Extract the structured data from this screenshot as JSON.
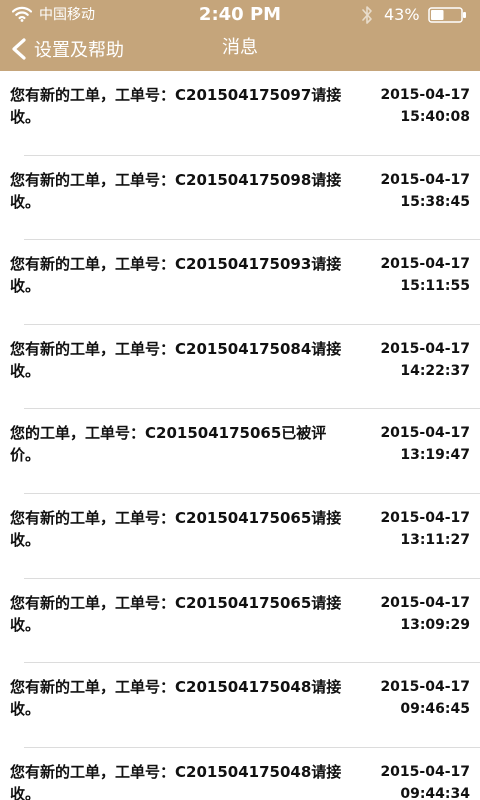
{
  "status_bar": {
    "carrier": "中国移动",
    "time": "2:40 PM",
    "battery_percent": "43%"
  },
  "nav": {
    "back_label": "设置及帮助",
    "title": "消息"
  },
  "colors": {
    "header_bg": "#c5a57b",
    "header_text": "#ffffff",
    "divider": "#dcdcdc"
  },
  "icons": {
    "wifi": "wifi-icon",
    "bluetooth": "bluetooth-icon",
    "battery": "battery-icon",
    "back": "chevron-left-icon"
  },
  "battery_level": 0.43,
  "messages": [
    {
      "text": "您有新的工单，工单号：C201504175097请接收。",
      "date": "2015-04-17",
      "time": "15:40:08"
    },
    {
      "text": "您有新的工单，工单号：C201504175098请接收。",
      "date": "2015-04-17",
      "time": "15:38:45"
    },
    {
      "text": "您有新的工单，工单号：C201504175093请接收。",
      "date": "2015-04-17",
      "time": "15:11:55"
    },
    {
      "text": "您有新的工单，工单号：C201504175084请接收。",
      "date": "2015-04-17",
      "time": "14:22:37"
    },
    {
      "text": "您的工单，工单号：C201504175065已被评价。",
      "date": "2015-04-17",
      "time": "13:19:47"
    },
    {
      "text": "您有新的工单，工单号：C201504175065请接收。",
      "date": "2015-04-17",
      "time": "13:11:27"
    },
    {
      "text": "您有新的工单，工单号：C201504175065请接收。",
      "date": "2015-04-17",
      "time": "13:09:29"
    },
    {
      "text": "您有新的工单，工单号：C201504175048请接收。",
      "date": "2015-04-17",
      "time": "09:46:45"
    },
    {
      "text": "您有新的工单，工单号：C201504175048请接收。",
      "date": "2015-04-17",
      "time": "09:44:34"
    }
  ]
}
